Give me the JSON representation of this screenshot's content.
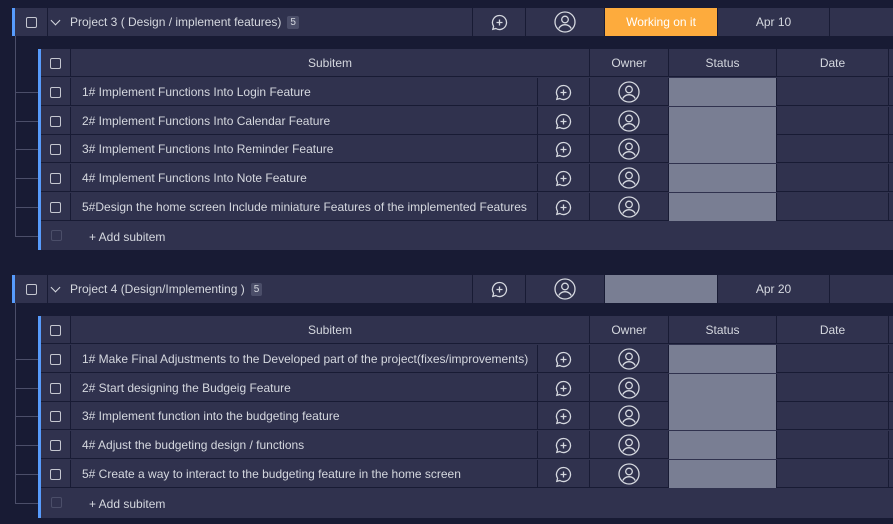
{
  "colors": {
    "bg": "#181b34",
    "row": "#30324e",
    "accent": "#579bfc",
    "working": "#fdab3d",
    "empty_status": "#797e93"
  },
  "groups": [
    {
      "title": "Project 3 ( Design / implement features)",
      "count": "5",
      "status": "Working on it",
      "date": "Apr 10",
      "columns": {
        "subitem": "Subitem",
        "owner": "Owner",
        "status": "Status",
        "date": "Date"
      },
      "subitems": [
        {
          "name": "1# Implement Functions Into Login Feature"
        },
        {
          "name": "2# Implement Functions Into Calendar Feature"
        },
        {
          "name": "3# Implement Functions Into Reminder Feature"
        },
        {
          "name": "4# Implement Functions Into Note Feature"
        },
        {
          "name": "5#Design the home screen Include miniature Features of the implemented Features"
        }
      ],
      "add_label": "+ Add subitem"
    },
    {
      "title": "Project 4 (Design/Implementing )",
      "count": "5",
      "status": "",
      "date": "Apr 20",
      "columns": {
        "subitem": "Subitem",
        "owner": "Owner",
        "status": "Status",
        "date": "Date"
      },
      "subitems": [
        {
          "name": "1# Make Final Adjustments to the Developed part of the project(fixes/improvements)"
        },
        {
          "name": "2# Start designing the Budgeig Feature"
        },
        {
          "name": "3# Implement function into the budgeting feature"
        },
        {
          "name": "4# Adjust the budgeting design / functions"
        },
        {
          "name": "5# Create a way to interact to the budgeting feature in the home screen"
        }
      ],
      "add_label": "+ Add subitem"
    }
  ]
}
